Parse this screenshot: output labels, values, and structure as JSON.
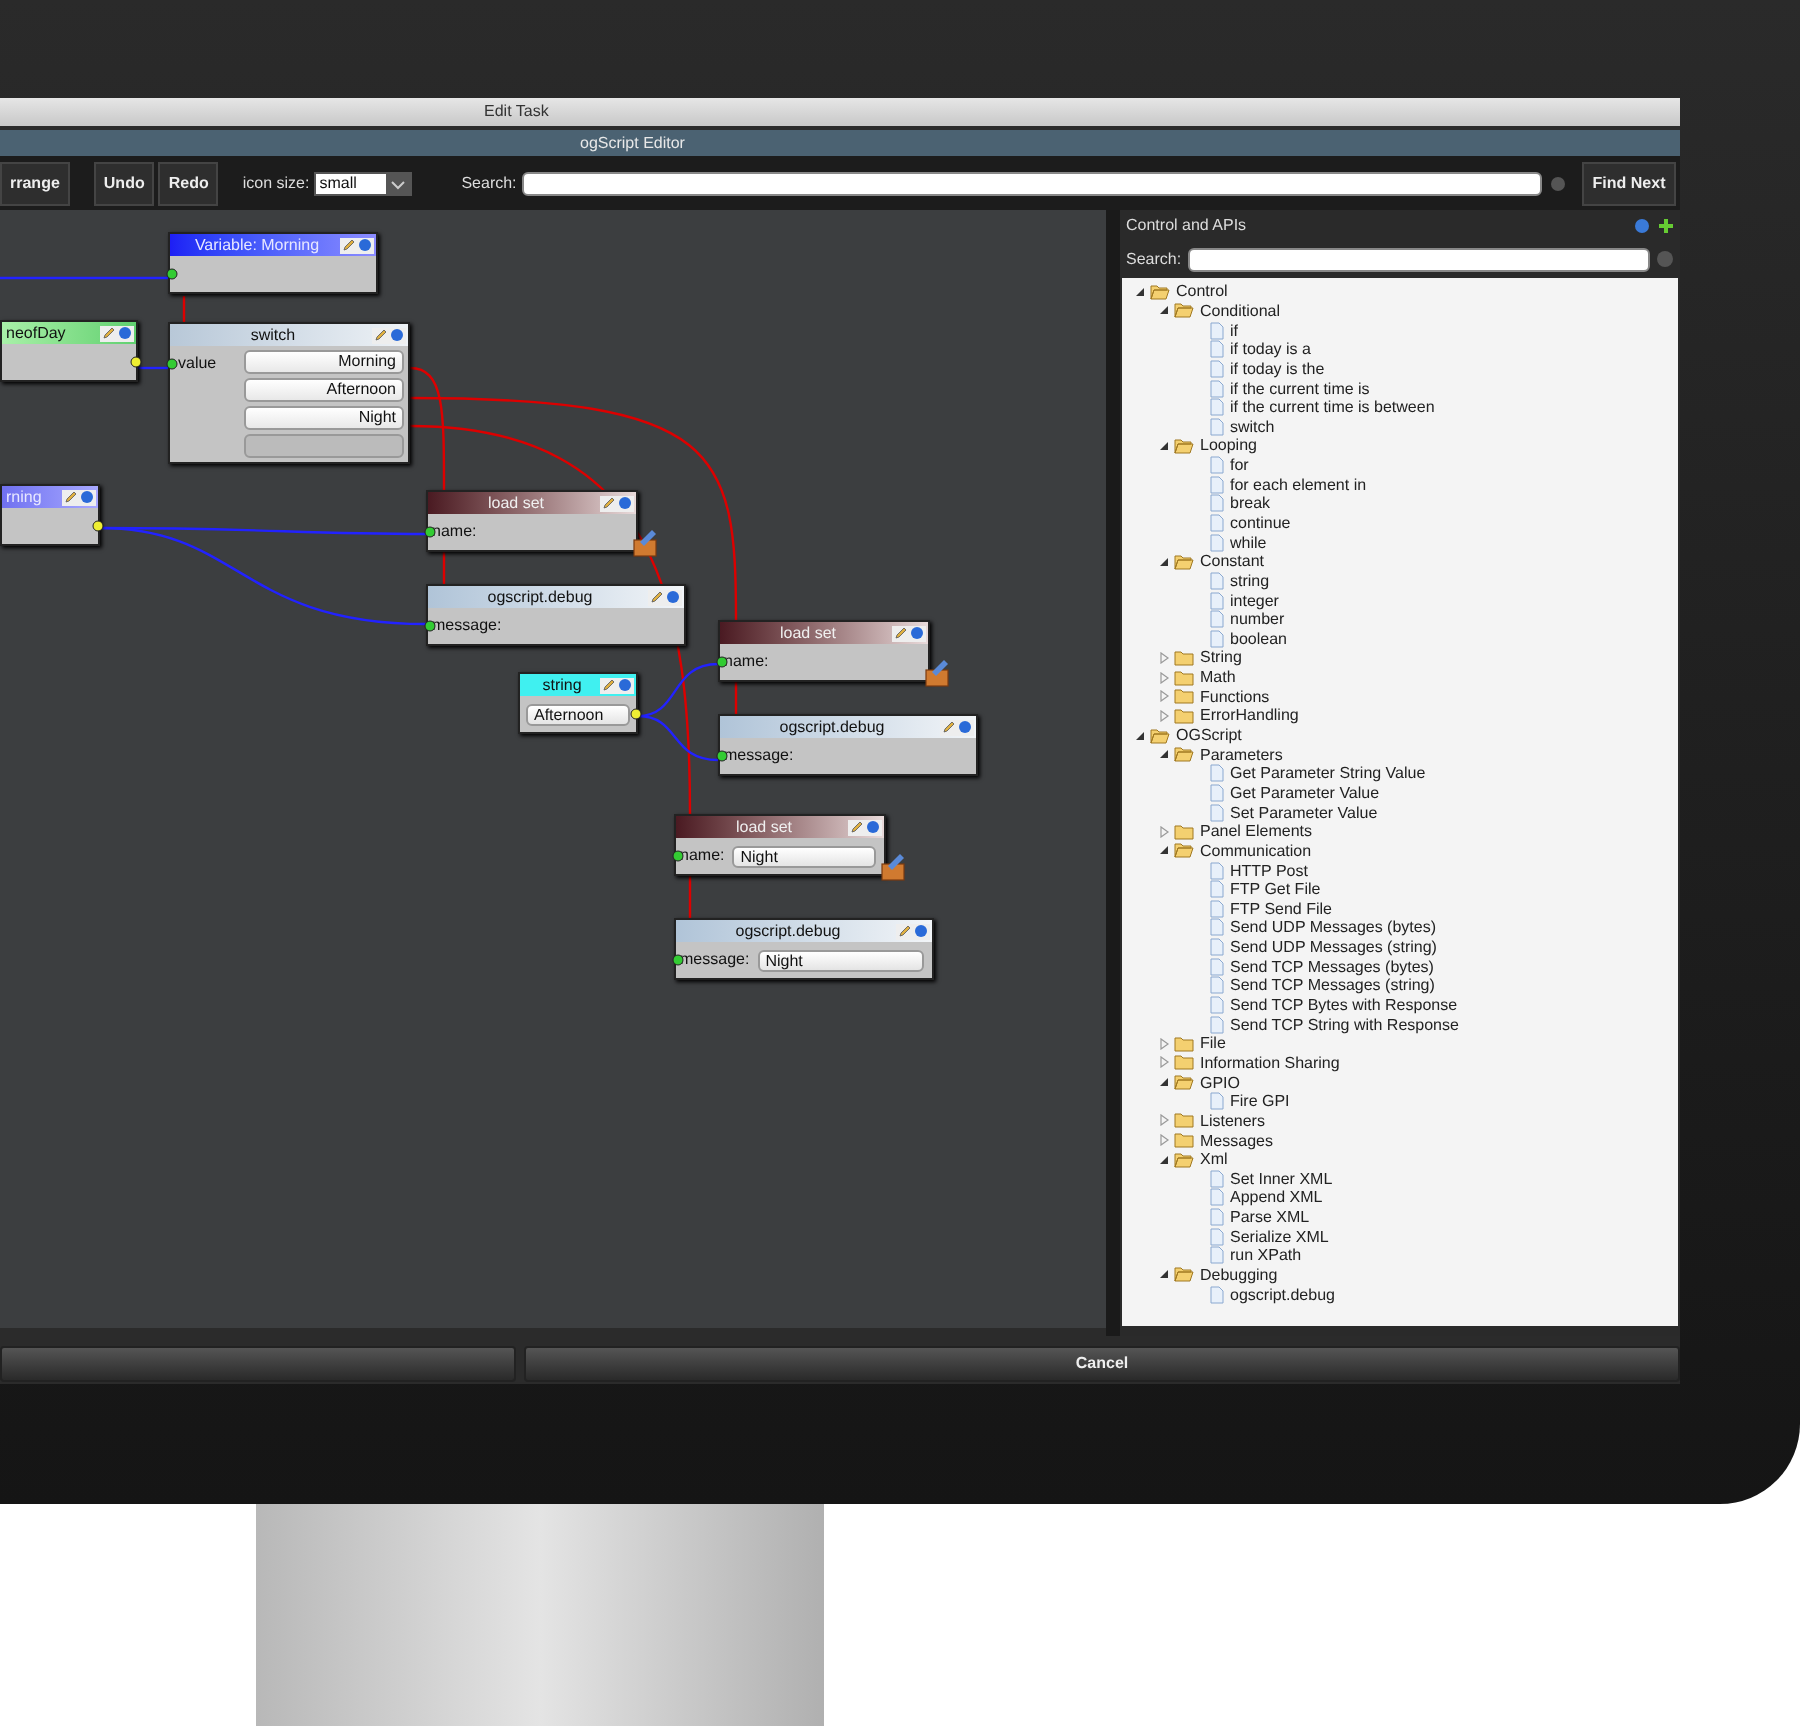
{
  "window": {
    "title": "Edit Task"
  },
  "editor": {
    "title": "ogScript Editor"
  },
  "toolbar": {
    "buttons": [
      "rrange",
      "Undo",
      "Redo"
    ],
    "icon_size_label": "icon size:",
    "icon_size_value": "small",
    "search_label": "Search:",
    "find_next": "Find Next"
  },
  "canvas": {
    "nodes": [
      {
        "kind": "variable",
        "title": "Variable: Morning"
      },
      {
        "kind": "parameter",
        "title": "neofDay"
      },
      {
        "kind": "switch",
        "title": "switch",
        "input": "value",
        "cases": [
          "Morning",
          "Afternoon",
          "Night"
        ]
      },
      {
        "kind": "reference",
        "title": "rning"
      },
      {
        "kind": "load_set",
        "title": "load set",
        "label": "name:"
      },
      {
        "kind": "debug",
        "title": "ogscript.debug",
        "label": "message:"
      },
      {
        "kind": "load_set",
        "title": "load set",
        "label": "name:"
      },
      {
        "kind": "string",
        "title": "string",
        "value": "Afternoon"
      },
      {
        "kind": "debug",
        "title": "ogscript.debug",
        "label": "message:"
      },
      {
        "kind": "load_set",
        "title": "load set",
        "label": "name:",
        "value": "Night"
      },
      {
        "kind": "debug",
        "title": "ogscript.debug",
        "label": "message:",
        "value": "Night"
      }
    ]
  },
  "panel": {
    "title": "Control and APIs",
    "search_label": "Search:",
    "tree": [
      {
        "kind": "folder",
        "label": "Control",
        "expanded": true,
        "children": [
          {
            "kind": "folder",
            "label": "Conditional",
            "expanded": true,
            "children": [
              {
                "kind": "leaf",
                "label": "if"
              },
              {
                "kind": "leaf",
                "label": "if today is a"
              },
              {
                "kind": "leaf",
                "label": "if today is the"
              },
              {
                "kind": "leaf",
                "label": "if the current time is"
              },
              {
                "kind": "leaf",
                "label": "if the current time is between"
              },
              {
                "kind": "leaf",
                "label": "switch"
              }
            ]
          },
          {
            "kind": "folder",
            "label": "Looping",
            "expanded": true,
            "children": [
              {
                "kind": "leaf",
                "label": "for"
              },
              {
                "kind": "leaf",
                "label": "for each element in"
              },
              {
                "kind": "leaf",
                "label": "break"
              },
              {
                "kind": "leaf",
                "label": "continue"
              },
              {
                "kind": "leaf",
                "label": "while"
              }
            ]
          },
          {
            "kind": "folder",
            "label": "Constant",
            "expanded": true,
            "children": [
              {
                "kind": "leaf",
                "label": "string"
              },
              {
                "kind": "leaf",
                "label": "integer"
              },
              {
                "kind": "leaf",
                "label": "number"
              },
              {
                "kind": "leaf",
                "label": "boolean"
              }
            ]
          },
          {
            "kind": "folder",
            "label": "String",
            "expanded": false
          },
          {
            "kind": "folder",
            "label": "Math",
            "expanded": false
          },
          {
            "kind": "folder",
            "label": "Functions",
            "expanded": false
          },
          {
            "kind": "folder",
            "label": "ErrorHandling",
            "expanded": false
          }
        ]
      },
      {
        "kind": "folder",
        "label": "OGScript",
        "expanded": true,
        "children": [
          {
            "kind": "folder",
            "label": "Parameters",
            "expanded": true,
            "children": [
              {
                "kind": "leaf",
                "label": "Get Parameter String Value"
              },
              {
                "kind": "leaf",
                "label": "Get Parameter Value"
              },
              {
                "kind": "leaf",
                "label": "Set Parameter Value"
              }
            ]
          },
          {
            "kind": "folder",
            "label": "Panel Elements",
            "expanded": false
          },
          {
            "kind": "folder",
            "label": "Communication",
            "expanded": true,
            "children": [
              {
                "kind": "leaf",
                "label": "HTTP Post"
              },
              {
                "kind": "leaf",
                "label": "FTP Get File"
              },
              {
                "kind": "leaf",
                "label": "FTP Send File"
              },
              {
                "kind": "leaf",
                "label": "Send UDP Messages (bytes)"
              },
              {
                "kind": "leaf",
                "label": "Send UDP Messages (string)"
              },
              {
                "kind": "leaf",
                "label": "Send TCP Messages (bytes)"
              },
              {
                "kind": "leaf",
                "label": "Send TCP Messages (string)"
              },
              {
                "kind": "leaf",
                "label": "Send TCP Bytes with Response"
              },
              {
                "kind": "leaf",
                "label": "Send TCP String with Response"
              }
            ]
          },
          {
            "kind": "folder",
            "label": "File",
            "expanded": false
          },
          {
            "kind": "folder",
            "label": "Information Sharing",
            "expanded": false
          },
          {
            "kind": "folder",
            "label": "GPIO",
            "expanded": true,
            "children": [
              {
                "kind": "leaf",
                "label": "Fire GPI"
              }
            ]
          },
          {
            "kind": "folder",
            "label": "Listeners",
            "expanded": false
          },
          {
            "kind": "folder",
            "label": "Messages",
            "expanded": false
          },
          {
            "kind": "folder",
            "label": "Xml",
            "expanded": true,
            "children": [
              {
                "kind": "leaf",
                "label": "Set Inner XML"
              },
              {
                "kind": "leaf",
                "label": "Append XML"
              },
              {
                "kind": "leaf",
                "label": "Parse XML"
              },
              {
                "kind": "leaf",
                "label": "Serialize XML"
              },
              {
                "kind": "leaf",
                "label": "run XPath"
              }
            ]
          },
          {
            "kind": "folder",
            "label": "Debugging",
            "expanded": true,
            "children": [
              {
                "kind": "leaf",
                "label": "ogscript.debug"
              }
            ]
          }
        ]
      }
    ]
  },
  "footer": {
    "cancel": "Cancel"
  }
}
